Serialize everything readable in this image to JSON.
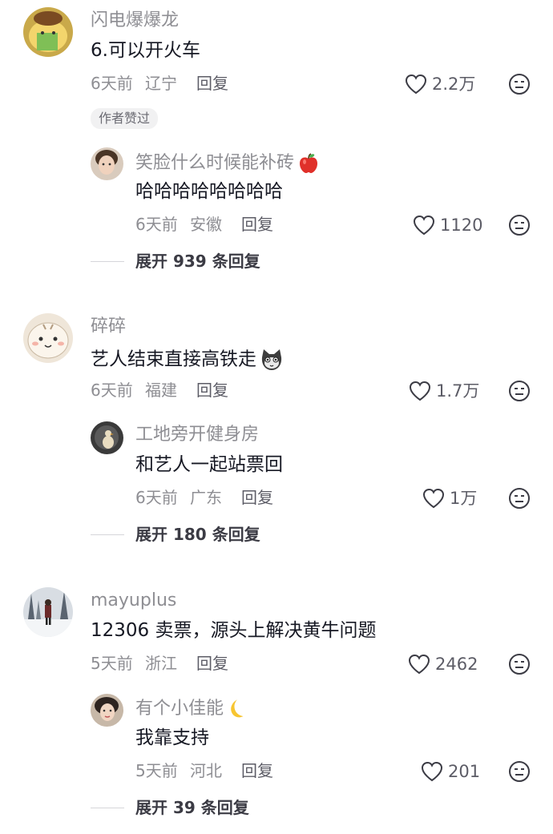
{
  "comments": [
    {
      "username": "闪电爆爆龙",
      "text": "6.可以开火车",
      "time": "6天前",
      "location": "辽宁",
      "reply_label": "回复",
      "likes": "2.2万",
      "badge": "作者赞过",
      "reply": {
        "username": "笑脸什么时候能补砖",
        "text": "哈哈哈哈哈哈哈哈",
        "time": "6天前",
        "location": "安徽",
        "reply_label": "回复",
        "likes": "1120"
      },
      "expand": {
        "prefix": "展开",
        "count": "939",
        "suffix": "条回复"
      }
    },
    {
      "username": "碎碎",
      "text": "艺人结束直接高铁走",
      "time": "6天前",
      "location": "福建",
      "reply_label": "回复",
      "likes": "1.7万",
      "reply": {
        "username": "工地旁开健身房",
        "text": "和艺人一起站票回",
        "time": "6天前",
        "location": "广东",
        "reply_label": "回复",
        "likes": "1万"
      },
      "expand": {
        "prefix": "展开",
        "count": "180",
        "suffix": "条回复"
      }
    },
    {
      "username": "mayuplus",
      "text": "12306 卖票，源头上解决黄牛问题",
      "time": "5天前",
      "location": "浙江",
      "reply_label": "回复",
      "likes": "2462",
      "reply": {
        "username": "有个小佳能",
        "text": "我靠支持",
        "time": "5天前",
        "location": "河北",
        "reply_label": "回复",
        "likes": "201"
      },
      "expand": {
        "prefix": "展开",
        "count": "39",
        "suffix": "条回复"
      }
    }
  ],
  "icons": {
    "like": "heart-outline-icon",
    "dislike": "dislike-face-icon",
    "apple": "red-apple-emoji",
    "cat": "cat-face-emoji",
    "moon": "crescent-moon-emoji"
  },
  "colors": {
    "username": "#8e8e93",
    "text": "#161823",
    "meta": "#8e8e93"
  }
}
